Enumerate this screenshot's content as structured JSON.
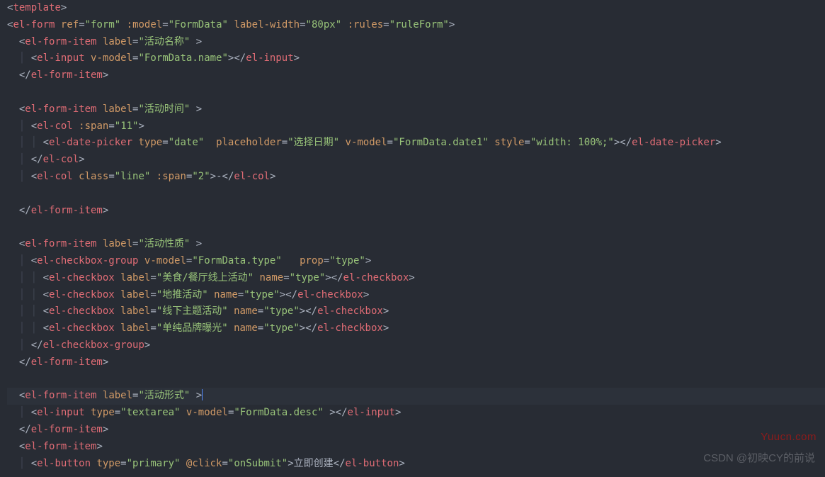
{
  "code": [
    [
      [
        "punc",
        "<"
      ],
      [
        "tag",
        "template"
      ],
      [
        "punc",
        ">"
      ]
    ],
    [
      [
        "punc",
        "<"
      ],
      [
        "tag",
        "el-form"
      ],
      [
        "txt",
        " "
      ],
      [
        "attr",
        "ref"
      ],
      [
        "eq",
        "="
      ],
      [
        "str",
        "\"form\""
      ],
      [
        "txt",
        " "
      ],
      [
        "attr",
        ":model"
      ],
      [
        "eq",
        "="
      ],
      [
        "str",
        "\"FormData\""
      ],
      [
        "txt",
        " "
      ],
      [
        "attr",
        "label-width"
      ],
      [
        "eq",
        "="
      ],
      [
        "str",
        "\"80px\""
      ],
      [
        "txt",
        " "
      ],
      [
        "attr",
        ":rules"
      ],
      [
        "eq",
        "="
      ],
      [
        "str",
        "\"ruleForm\""
      ],
      [
        "punc",
        ">"
      ]
    ],
    [
      [
        "guide",
        "  "
      ],
      [
        "punc",
        "<"
      ],
      [
        "tag",
        "el-form-item"
      ],
      [
        "txt",
        " "
      ],
      [
        "attr",
        "label"
      ],
      [
        "eq",
        "="
      ],
      [
        "str",
        "\"活动名称\""
      ],
      [
        "txt",
        " "
      ],
      [
        "punc",
        ">"
      ]
    ],
    [
      [
        "guide",
        "  │ "
      ],
      [
        "punc",
        "<"
      ],
      [
        "tag",
        "el-input"
      ],
      [
        "txt",
        " "
      ],
      [
        "attr",
        "v-model"
      ],
      [
        "eq",
        "="
      ],
      [
        "str",
        "\"FormData.name\""
      ],
      [
        "punc",
        "></"
      ],
      [
        "tag",
        "el-input"
      ],
      [
        "punc",
        ">"
      ]
    ],
    [
      [
        "guide",
        "  "
      ],
      [
        "punc",
        "</"
      ],
      [
        "tag",
        "el-form-item"
      ],
      [
        "punc",
        ">"
      ]
    ],
    [],
    [
      [
        "guide",
        "  "
      ],
      [
        "punc",
        "<"
      ],
      [
        "tag",
        "el-form-item"
      ],
      [
        "txt",
        " "
      ],
      [
        "attr",
        "label"
      ],
      [
        "eq",
        "="
      ],
      [
        "str",
        "\"活动时间\""
      ],
      [
        "txt",
        " "
      ],
      [
        "punc",
        ">"
      ]
    ],
    [
      [
        "guide",
        "  │ "
      ],
      [
        "punc",
        "<"
      ],
      [
        "tag",
        "el-col"
      ],
      [
        "txt",
        " "
      ],
      [
        "attr",
        ":span"
      ],
      [
        "eq",
        "="
      ],
      [
        "str",
        "\"11\""
      ],
      [
        "punc",
        ">"
      ]
    ],
    [
      [
        "guide",
        "  │ │ "
      ],
      [
        "punc",
        "<"
      ],
      [
        "tag",
        "el-date-picker"
      ],
      [
        "txt",
        " "
      ],
      [
        "attr",
        "type"
      ],
      [
        "eq",
        "="
      ],
      [
        "str",
        "\"date\""
      ],
      [
        "txt",
        "  "
      ],
      [
        "attr",
        "placeholder"
      ],
      [
        "eq",
        "="
      ],
      [
        "str",
        "\"选择日期\""
      ],
      [
        "txt",
        " "
      ],
      [
        "attr",
        "v-model"
      ],
      [
        "eq",
        "="
      ],
      [
        "str",
        "\"FormData.date1\""
      ],
      [
        "txt",
        " "
      ],
      [
        "attr",
        "style"
      ],
      [
        "eq",
        "="
      ],
      [
        "str",
        "\"width: 100%;\""
      ],
      [
        "punc",
        "></"
      ],
      [
        "tag",
        "el-date-picker"
      ],
      [
        "punc",
        ">"
      ]
    ],
    [
      [
        "guide",
        "  │ "
      ],
      [
        "punc",
        "</"
      ],
      [
        "tag",
        "el-col"
      ],
      [
        "punc",
        ">"
      ]
    ],
    [
      [
        "guide",
        "  │ "
      ],
      [
        "punc",
        "<"
      ],
      [
        "tag",
        "el-col"
      ],
      [
        "txt",
        " "
      ],
      [
        "attr",
        "class"
      ],
      [
        "eq",
        "="
      ],
      [
        "str",
        "\"line\""
      ],
      [
        "txt",
        " "
      ],
      [
        "attr",
        ":span"
      ],
      [
        "eq",
        "="
      ],
      [
        "str",
        "\"2\""
      ],
      [
        "punc",
        ">"
      ],
      [
        "txt",
        "-"
      ],
      [
        "punc",
        "</"
      ],
      [
        "tag",
        "el-col"
      ],
      [
        "punc",
        ">"
      ]
    ],
    [],
    [
      [
        "guide",
        "  "
      ],
      [
        "punc",
        "</"
      ],
      [
        "tag",
        "el-form-item"
      ],
      [
        "punc",
        ">"
      ]
    ],
    [],
    [
      [
        "guide",
        "  "
      ],
      [
        "punc",
        "<"
      ],
      [
        "tag",
        "el-form-item"
      ],
      [
        "txt",
        " "
      ],
      [
        "attr",
        "label"
      ],
      [
        "eq",
        "="
      ],
      [
        "str",
        "\"活动性质\""
      ],
      [
        "txt",
        " "
      ],
      [
        "punc",
        ">"
      ]
    ],
    [
      [
        "guide",
        "  │ "
      ],
      [
        "punc",
        "<"
      ],
      [
        "tag",
        "el-checkbox-group"
      ],
      [
        "txt",
        " "
      ],
      [
        "attr",
        "v-model"
      ],
      [
        "eq",
        "="
      ],
      [
        "str",
        "\"FormData.type\""
      ],
      [
        "txt",
        "   "
      ],
      [
        "attr",
        "prop"
      ],
      [
        "eq",
        "="
      ],
      [
        "str",
        "\"type\""
      ],
      [
        "punc",
        ">"
      ]
    ],
    [
      [
        "guide",
        "  │ │ "
      ],
      [
        "punc",
        "<"
      ],
      [
        "tag",
        "el-checkbox"
      ],
      [
        "txt",
        " "
      ],
      [
        "attr",
        "label"
      ],
      [
        "eq",
        "="
      ],
      [
        "str",
        "\"美食/餐厅线上活动\""
      ],
      [
        "txt",
        " "
      ],
      [
        "attr",
        "name"
      ],
      [
        "eq",
        "="
      ],
      [
        "str",
        "\"type\""
      ],
      [
        "punc",
        "></"
      ],
      [
        "tag",
        "el-checkbox"
      ],
      [
        "punc",
        ">"
      ]
    ],
    [
      [
        "guide",
        "  │ │ "
      ],
      [
        "punc",
        "<"
      ],
      [
        "tag",
        "el-checkbox"
      ],
      [
        "txt",
        " "
      ],
      [
        "attr",
        "label"
      ],
      [
        "eq",
        "="
      ],
      [
        "str",
        "\"地推活动\""
      ],
      [
        "txt",
        " "
      ],
      [
        "attr",
        "name"
      ],
      [
        "eq",
        "="
      ],
      [
        "str",
        "\"type\""
      ],
      [
        "punc",
        "></"
      ],
      [
        "tag",
        "el-checkbox"
      ],
      [
        "punc",
        ">"
      ]
    ],
    [
      [
        "guide",
        "  │ │ "
      ],
      [
        "punc",
        "<"
      ],
      [
        "tag",
        "el-checkbox"
      ],
      [
        "txt",
        " "
      ],
      [
        "attr",
        "label"
      ],
      [
        "eq",
        "="
      ],
      [
        "str",
        "\"线下主题活动\""
      ],
      [
        "txt",
        " "
      ],
      [
        "attr",
        "name"
      ],
      [
        "eq",
        "="
      ],
      [
        "str",
        "\"type\""
      ],
      [
        "punc",
        "></"
      ],
      [
        "tag",
        "el-checkbox"
      ],
      [
        "punc",
        ">"
      ]
    ],
    [
      [
        "guide",
        "  │ │ "
      ],
      [
        "punc",
        "<"
      ],
      [
        "tag",
        "el-checkbox"
      ],
      [
        "txt",
        " "
      ],
      [
        "attr",
        "label"
      ],
      [
        "eq",
        "="
      ],
      [
        "str",
        "\"单纯品牌曝光\""
      ],
      [
        "txt",
        " "
      ],
      [
        "attr",
        "name"
      ],
      [
        "eq",
        "="
      ],
      [
        "str",
        "\"type\""
      ],
      [
        "punc",
        "></"
      ],
      [
        "tag",
        "el-checkbox"
      ],
      [
        "punc",
        ">"
      ]
    ],
    [
      [
        "guide",
        "  │ "
      ],
      [
        "punc",
        "</"
      ],
      [
        "tag",
        "el-checkbox-group"
      ],
      [
        "punc",
        ">"
      ]
    ],
    [
      [
        "guide",
        "  "
      ],
      [
        "punc",
        "</"
      ],
      [
        "tag",
        "el-form-item"
      ],
      [
        "punc",
        ">"
      ]
    ],
    [],
    {
      "hl": true,
      "tokens": [
        [
          "guide",
          "  "
        ],
        [
          "punc",
          "<"
        ],
        [
          "tag",
          "el-form-item"
        ],
        [
          "txt",
          " "
        ],
        [
          "attr",
          "label"
        ],
        [
          "eq",
          "="
        ],
        [
          "str",
          "\"活动形式\""
        ],
        [
          "txt",
          " "
        ],
        [
          "punc",
          ">"
        ],
        [
          "cursor",
          ""
        ]
      ]
    },
    [
      [
        "guide",
        "  │ "
      ],
      [
        "punc",
        "<"
      ],
      [
        "tag",
        "el-input"
      ],
      [
        "txt",
        " "
      ],
      [
        "attr",
        "type"
      ],
      [
        "eq",
        "="
      ],
      [
        "str",
        "\"textarea\""
      ],
      [
        "txt",
        " "
      ],
      [
        "attr",
        "v-model"
      ],
      [
        "eq",
        "="
      ],
      [
        "str",
        "\"FormData.desc\""
      ],
      [
        "txt",
        " "
      ],
      [
        "punc",
        "></"
      ],
      [
        "tag",
        "el-input"
      ],
      [
        "punc",
        ">"
      ]
    ],
    [
      [
        "guide",
        "  "
      ],
      [
        "punc",
        "</"
      ],
      [
        "tag",
        "el-form-item"
      ],
      [
        "punc",
        ">"
      ]
    ],
    [
      [
        "guide",
        "  "
      ],
      [
        "punc",
        "<"
      ],
      [
        "tag",
        "el-form-item"
      ],
      [
        "punc",
        ">"
      ]
    ],
    [
      [
        "guide",
        "  │ "
      ],
      [
        "punc",
        "<"
      ],
      [
        "tag",
        "el-button"
      ],
      [
        "txt",
        " "
      ],
      [
        "attr",
        "type"
      ],
      [
        "eq",
        "="
      ],
      [
        "str",
        "\"primary\""
      ],
      [
        "txt",
        " "
      ],
      [
        "attr",
        "@click"
      ],
      [
        "eq",
        "="
      ],
      [
        "str",
        "\"onSubmit\""
      ],
      [
        "punc",
        ">"
      ],
      [
        "txt",
        "立即创建"
      ],
      [
        "punc",
        "</"
      ],
      [
        "tag",
        "el-button"
      ],
      [
        "punc",
        ">"
      ]
    ]
  ],
  "watermarks": {
    "top": "Yuucn.com",
    "bottom": "CSDN @初映CY的前说"
  }
}
